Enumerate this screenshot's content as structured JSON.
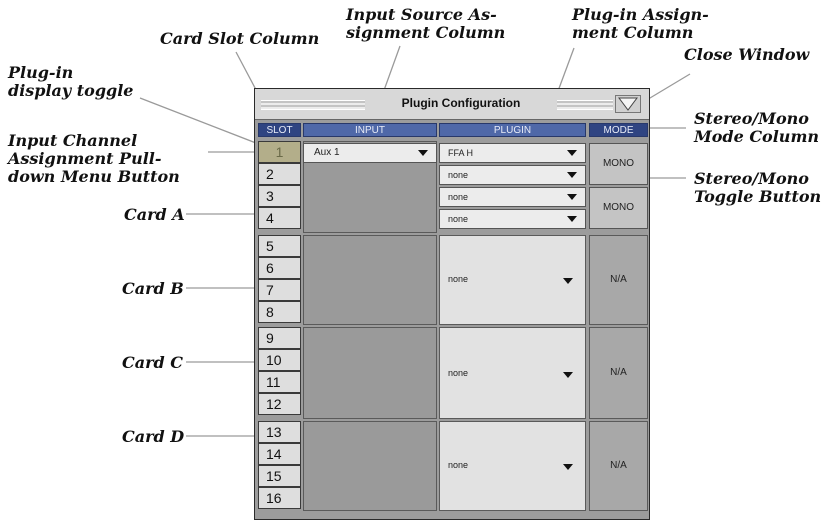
{
  "callouts": {
    "card_slot_column": "Card Slot Column",
    "input_source_column": "Input Source As-\nsignment Column",
    "plugin_assignment_column": "Plug-in Assign-\nment Column",
    "close_window": "Close Window",
    "plugin_display_toggle": "Plug-in\ndisplay toggle",
    "stereo_mono_mode_column": "Stereo/Mono\nMode Column",
    "input_channel_pulldown": "Input Channel\nAssignment Pull-\ndown Menu Button",
    "stereo_mono_toggle": "Stereo/Mono\nToggle Button",
    "card_a": "Card A",
    "card_b": "Card B",
    "card_c": "Card C",
    "card_d": "Card D"
  },
  "window": {
    "title": "Plugin Configuration",
    "headers": {
      "slot": "SLOT",
      "input": "INPUT",
      "plugin": "PLUGIN",
      "mode": "MODE"
    },
    "slots": [
      "1",
      "2",
      "3",
      "4",
      "5",
      "6",
      "7",
      "8",
      "9",
      "10",
      "11",
      "12",
      "13",
      "14",
      "15",
      "16"
    ],
    "input_value": "Aux 1",
    "card_a_plugins": [
      "FFA H",
      "none",
      "none",
      "none"
    ],
    "card_a_modes": [
      "MONO",
      "MONO"
    ],
    "card_b": {
      "plugin": "none",
      "mode": "N/A"
    },
    "card_c": {
      "plugin": "none",
      "mode": "N/A"
    },
    "card_d": {
      "plugin": "none",
      "mode": "N/A"
    }
  }
}
